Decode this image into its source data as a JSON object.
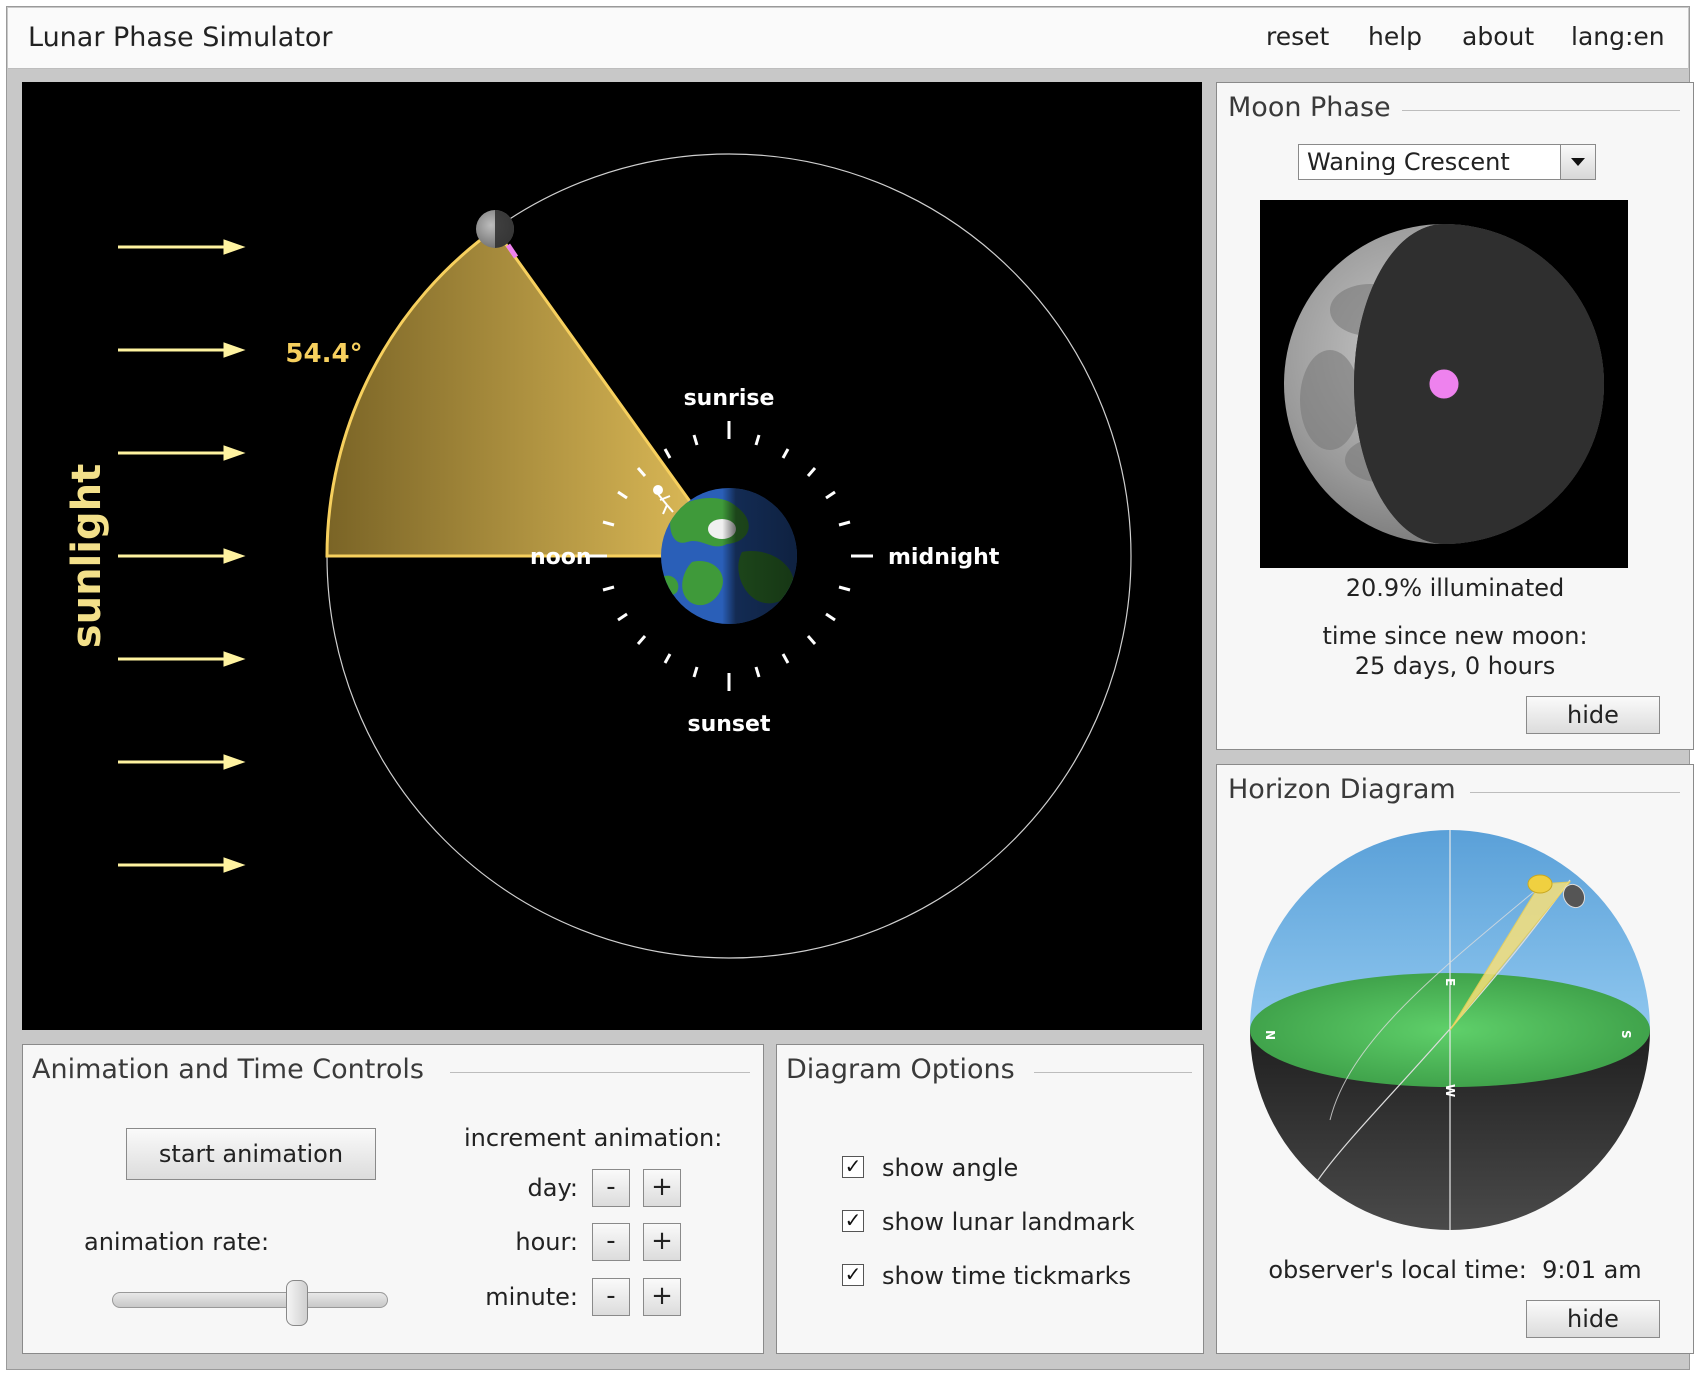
{
  "app": {
    "title": "Lunar Phase Simulator"
  },
  "menu": {
    "reset": "reset",
    "help": "help",
    "about": "about",
    "lang": "lang:en"
  },
  "orbit_view": {
    "sunlight_label": "sunlight",
    "angle_label": "54.4°",
    "time_labels": {
      "sunrise": "sunrise",
      "noon": "noon",
      "midnight": "midnight",
      "sunset": "sunset"
    },
    "colors": {
      "sunlight": "#fff3a0",
      "angle_wedge": "#f7d05e",
      "landmark": "#ee82ee"
    }
  },
  "moon_phase": {
    "title": "Moon Phase",
    "phase_selected": "Waning Crescent",
    "illuminated": "20.9% illuminated",
    "time_since_label": "time since new moon:",
    "time_since_value": "25 days, 0 hours",
    "hide_label": "hide"
  },
  "horizon": {
    "title": "Horizon Diagram",
    "directions": {
      "north": "N",
      "south": "S",
      "east": "E",
      "west": "W"
    },
    "local_time_label": "observer's local time:",
    "local_time_value": "9:01 am",
    "hide_label": "hide",
    "colors": {
      "sky": "#6fb0e0",
      "ground": "#4cbf5a",
      "below": "#2f2f2f"
    }
  },
  "animation": {
    "title": "Animation and Time Controls",
    "start_label": "start animation",
    "rate_label": "animation rate:",
    "rate_value": 0.68,
    "increment_label": "increment animation:",
    "day_label": "day:",
    "hour_label": "hour:",
    "minute_label": "minute:",
    "minus": "-",
    "plus": "+"
  },
  "options": {
    "title": "Diagram Options",
    "items": [
      {
        "label": "show angle",
        "checked": true
      },
      {
        "label": "show lunar landmark",
        "checked": true
      },
      {
        "label": "show time tickmarks",
        "checked": true
      }
    ]
  }
}
